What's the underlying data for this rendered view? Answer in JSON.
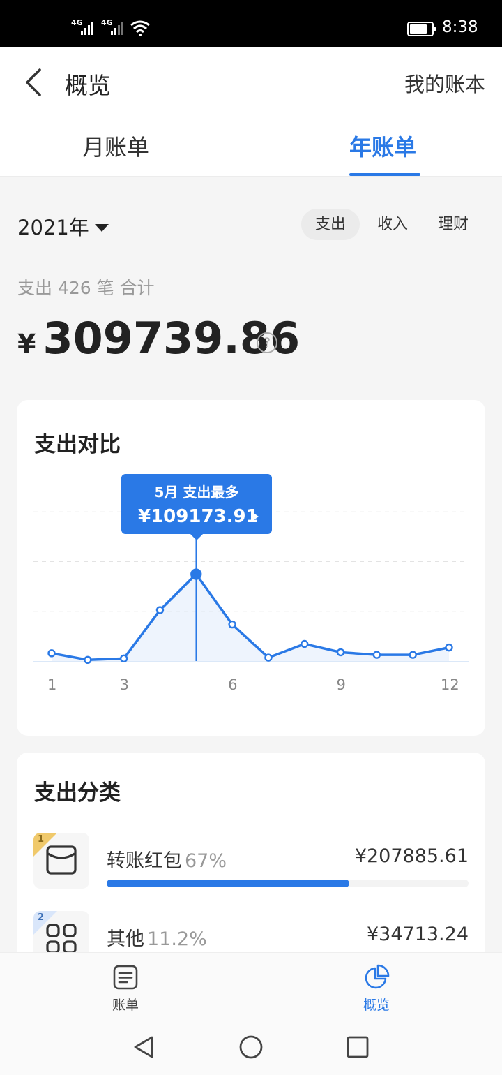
{
  "status_bar": {
    "signal_1": "4G",
    "signal_2": "4G",
    "time": "8:38"
  },
  "header": {
    "title": "概览",
    "right_link": "我的账本",
    "tabs": [
      {
        "label": "月账单",
        "active": false
      },
      {
        "label": "年账单",
        "active": true
      }
    ]
  },
  "summary": {
    "year": "2021年",
    "segments": [
      {
        "label": "支出",
        "active": true
      },
      {
        "label": "收入",
        "active": false
      },
      {
        "label": "理财",
        "active": false
      }
    ],
    "count_text": "支出 426 笔 合计",
    "currency": "¥",
    "total": "309739.86",
    "help_icon": "?"
  },
  "comparison_card": {
    "title": "支出对比",
    "tooltip": {
      "title": "5月 支出最多",
      "value": "¥109173.91"
    }
  },
  "chart_data": {
    "type": "area",
    "x": [
      1,
      2,
      3,
      4,
      5,
      6,
      7,
      8,
      9,
      10,
      11,
      12
    ],
    "x_tick_labels": [
      "1",
      "3",
      "6",
      "9",
      "12"
    ],
    "series": [
      {
        "values": [
          9800,
          1500,
          3200,
          64000,
          109173.91,
          46000,
          4300,
          21500,
          11000,
          7800,
          7800,
          17000
        ]
      }
    ],
    "ylim": [
      0,
      250000
    ],
    "highlight": {
      "x": 5,
      "value": 109173.91
    },
    "grid": "dashed horizontal",
    "accent": "#2a79e6"
  },
  "category_card": {
    "title": "支出分类",
    "items": [
      {
        "rank": "1",
        "name": "转账红包",
        "percent": "67%",
        "amount": "¥207885.61",
        "share": 0.67,
        "icon": "wallet-icon"
      },
      {
        "rank": "2",
        "name": "其他",
        "percent": "11.2%",
        "amount": "¥34713.24",
        "share": 0.112,
        "icon": "grid-icon"
      }
    ]
  },
  "bottom_nav": {
    "items": [
      {
        "label": "账单",
        "active": false,
        "icon": "bill-icon"
      },
      {
        "label": "概览",
        "active": true,
        "icon": "pie-chart-icon"
      }
    ]
  },
  "colors": {
    "accent": "#2a79e6",
    "rank_1": "#f0c96b",
    "rank_2": "#d9e6fa"
  }
}
